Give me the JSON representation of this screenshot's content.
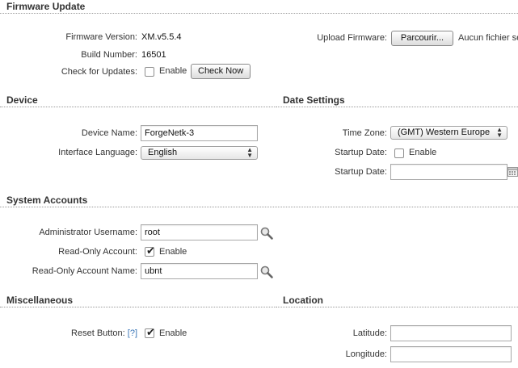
{
  "firmware_update": {
    "title": "Firmware Update",
    "version_label": "Firmware Version:",
    "version_value": "XM.v5.5.4",
    "build_label": "Build Number:",
    "build_value": "16501",
    "check_label": "Check for Updates:",
    "check_enable": "Enable",
    "check_now": "Check Now",
    "upload_label": "Upload Firmware:",
    "browse_button": "Parcourir...",
    "no_file": "Aucun fichier sélectionné."
  },
  "device": {
    "title": "Device",
    "name_label": "Device Name:",
    "name_value": "ForgeNetk-3",
    "language_label": "Interface Language:",
    "language_value": "English"
  },
  "date_settings": {
    "title": "Date Settings",
    "timezone_label": "Time Zone:",
    "timezone_value": "(GMT) Western Europe",
    "startup_label": "Startup Date:",
    "startup_enable": "Enable",
    "startup_date_label": "Startup Date:",
    "startup_date_value": ""
  },
  "system_accounts": {
    "title": "System Accounts",
    "admin_label": "Administrator Username:",
    "admin_value": "root",
    "readonly_label": "Read-Only Account:",
    "readonly_enable": "Enable",
    "readonly_checked": true,
    "readonly_name_label": "Read-Only Account Name:",
    "readonly_name_value": "ubnt"
  },
  "miscellaneous": {
    "title": "Miscellaneous",
    "reset_label": "Reset Button:",
    "reset_help": "[?]",
    "reset_enable": "Enable",
    "reset_checked": true
  },
  "location": {
    "title": "Location",
    "latitude_label": "Latitude:",
    "latitude_value": "",
    "longitude_label": "Longitude:",
    "longitude_value": ""
  },
  "icons": {
    "check_mark": "✔",
    "search_icon": "magnifier-icon",
    "calendar_icon": "calendar-icon"
  }
}
